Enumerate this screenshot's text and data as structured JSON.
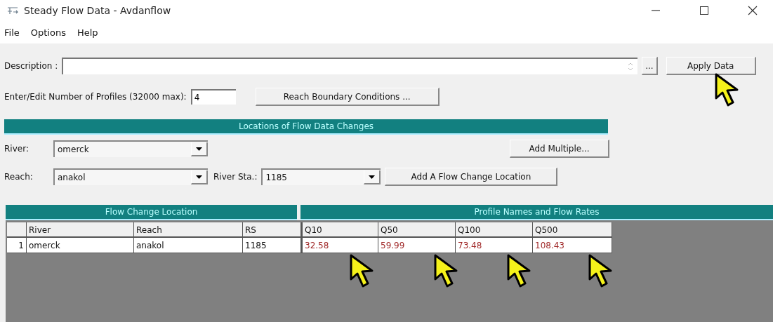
{
  "window": {
    "title": "Steady Flow Data - Avdanflow"
  },
  "menu": [
    "File",
    "Options",
    "Help"
  ],
  "description": {
    "label": "Description :",
    "ellipsis": "...",
    "apply": "Apply Data"
  },
  "profiles": {
    "label": "Enter/Edit Number of Profiles (32000 max):",
    "value": "4",
    "button": "Reach Boundary Conditions ..."
  },
  "locations": {
    "title": "Locations of Flow Data Changes",
    "river_label": "River:",
    "river": "omerck",
    "reach_label": "Reach:",
    "reach": "anakol",
    "station_label": "River Sta.:",
    "station": "1185",
    "add_multiple": "Add Multiple...",
    "add_location": "Add A Flow Change Location"
  },
  "table": {
    "group_left": "Flow Change Location",
    "group_right": "Profile Names and Flow Rates",
    "columns": [
      "River",
      "Reach",
      "RS",
      "Q10",
      "Q50",
      "Q100",
      "Q500"
    ],
    "rows": [
      {
        "index": "1",
        "cells": [
          "omerck",
          "anakol",
          "1185",
          "32.58",
          "59.99",
          "73.48",
          "108.43"
        ]
      }
    ]
  }
}
